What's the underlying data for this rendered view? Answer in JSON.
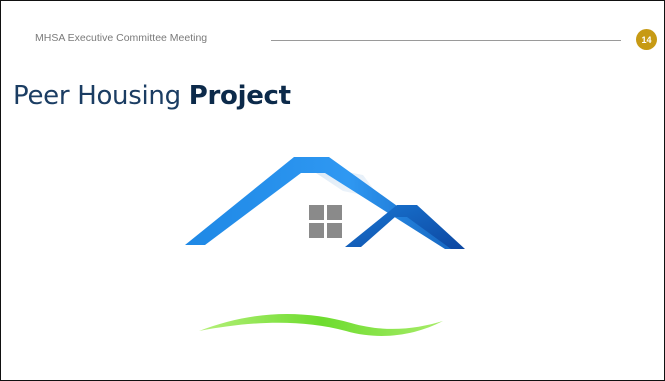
{
  "header": {
    "label": "MHSA Executive Committee Meeting",
    "page_number": "14"
  },
  "title": {
    "part1": "Peer Housing",
    "part2": "Project"
  },
  "colors": {
    "badge": "#c79a14",
    "title": "#1b3d63",
    "roof_primary": "#1e88e5",
    "roof_secondary": "#0d5fb8",
    "window": "#808080",
    "swoosh": "#7ddf3a"
  },
  "logo": {
    "icon": "house-roof-logo"
  }
}
